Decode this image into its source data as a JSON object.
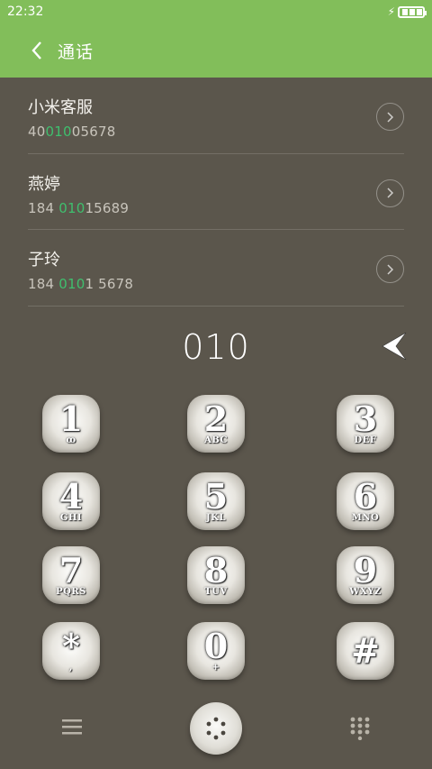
{
  "status": {
    "time": "22:32"
  },
  "header": {
    "title": "通话"
  },
  "contacts": [
    {
      "name": "小米客服",
      "number_pre": "40",
      "number_match": "010",
      "number_post": "05678"
    },
    {
      "name": "燕婷",
      "number_pre": "184 ",
      "number_match": "010",
      "number_post": "15689"
    },
    {
      "name": "子玲",
      "number_pre": "184 ",
      "number_match": "010",
      "number_post": "1 5678"
    }
  ],
  "dial": {
    "number": "010"
  },
  "keys": [
    {
      "digit": "1",
      "letters": "ꝏ"
    },
    {
      "digit": "2",
      "letters": "ABC"
    },
    {
      "digit": "3",
      "letters": "DEF"
    },
    {
      "digit": "4",
      "letters": "GHI"
    },
    {
      "digit": "5",
      "letters": "JKL"
    },
    {
      "digit": "6",
      "letters": "MNO"
    },
    {
      "digit": "7",
      "letters": "PQRS"
    },
    {
      "digit": "8",
      "letters": "TUV"
    },
    {
      "digit": "9",
      "letters": "WXYZ"
    },
    {
      "digit": "*",
      "letters": ","
    },
    {
      "digit": "0",
      "letters": "+"
    },
    {
      "digit": "#",
      "letters": ""
    }
  ],
  "colors": {
    "accent": "#82be5a",
    "background": "#5b564c",
    "match_highlight": "#3fbf6e"
  },
  "icons": {
    "back": "chevron-left-icon",
    "backspace": "backspace-arrow-icon",
    "menu": "menu-icon",
    "dial": "dial-pad-icon",
    "keypad_toggle": "keypad-grid-icon"
  }
}
